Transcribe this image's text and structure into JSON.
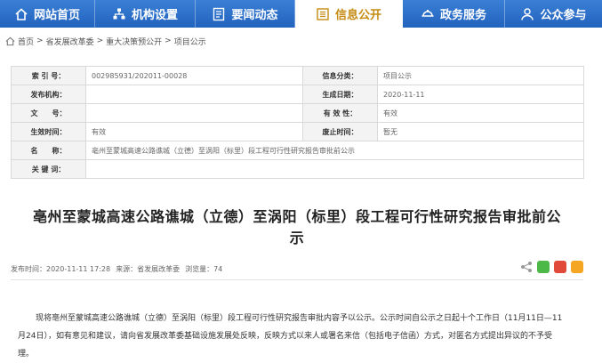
{
  "nav": {
    "items": [
      {
        "label": "网站首页",
        "icon": "home-icon"
      },
      {
        "label": "机构设置",
        "icon": "org-icon"
      },
      {
        "label": "要闻动态",
        "icon": "news-icon"
      },
      {
        "label": "信息公开",
        "icon": "info-icon",
        "active": true
      },
      {
        "label": "政务服务",
        "icon": "service-icon"
      },
      {
        "label": "公众参与",
        "icon": "people-icon"
      }
    ],
    "active_color": "#c58b12",
    "bar_color": "#2263bd"
  },
  "breadcrumb": {
    "home": "首页",
    "items": [
      "省发展改革委",
      "重大决策预公开",
      "项目公示"
    ],
    "sep": ">"
  },
  "info": {
    "index_label": "索 引 号：",
    "index_value": "002985931/202011-00028",
    "category_label": "信息分类：",
    "category_value": "项目公示",
    "issuer_label": "发布机构：",
    "issuer_value": "",
    "date_label": "生成日期：",
    "date_value": "2020-11-11",
    "docno_label": "文　　号：",
    "docno_value": "",
    "validity_label": "有 效 性：",
    "validity_value": "有效",
    "effective_label": "生效时间：",
    "effective_value": "有效",
    "repeal_label": "废止时间：",
    "repeal_value": "暂无",
    "name_label": "名　　称：",
    "name_value": "亳州至蒙城高速公路谯城（立德）至涡阳（标里）段工程可行性研究报告审批前公示",
    "keywords_label": "关 键 词：",
    "keywords_value": ""
  },
  "article": {
    "title_line1": "亳州至蒙城高速公路谯城（立德）至涡阳（标里）段工程可行性研究报告审批前公",
    "title_line2": "示",
    "publish_time": "发布时间：2020-11-11 17:28",
    "source": "来源：省发展改革委",
    "views": "浏览量：74",
    "para_line1": "现将亳州至蒙城高速公路谯城（立德）至涡阳（标里）段工程可行性研究报告审批内容予以公示。公示时间自公示之日起十个工作日（11月11日—11",
    "para_line2": "月24日），如有意见和建议，请向省发展改革委基础设施发展处反映，反映方式以来人或署名来信（包括电子信函）方式，对匿名方式提出异议的不予受",
    "para_line3": "理。"
  },
  "share": {
    "wechat_color": "#4cb848",
    "weibo_color": "#e1493b",
    "qzone_color": "#f5a623"
  }
}
